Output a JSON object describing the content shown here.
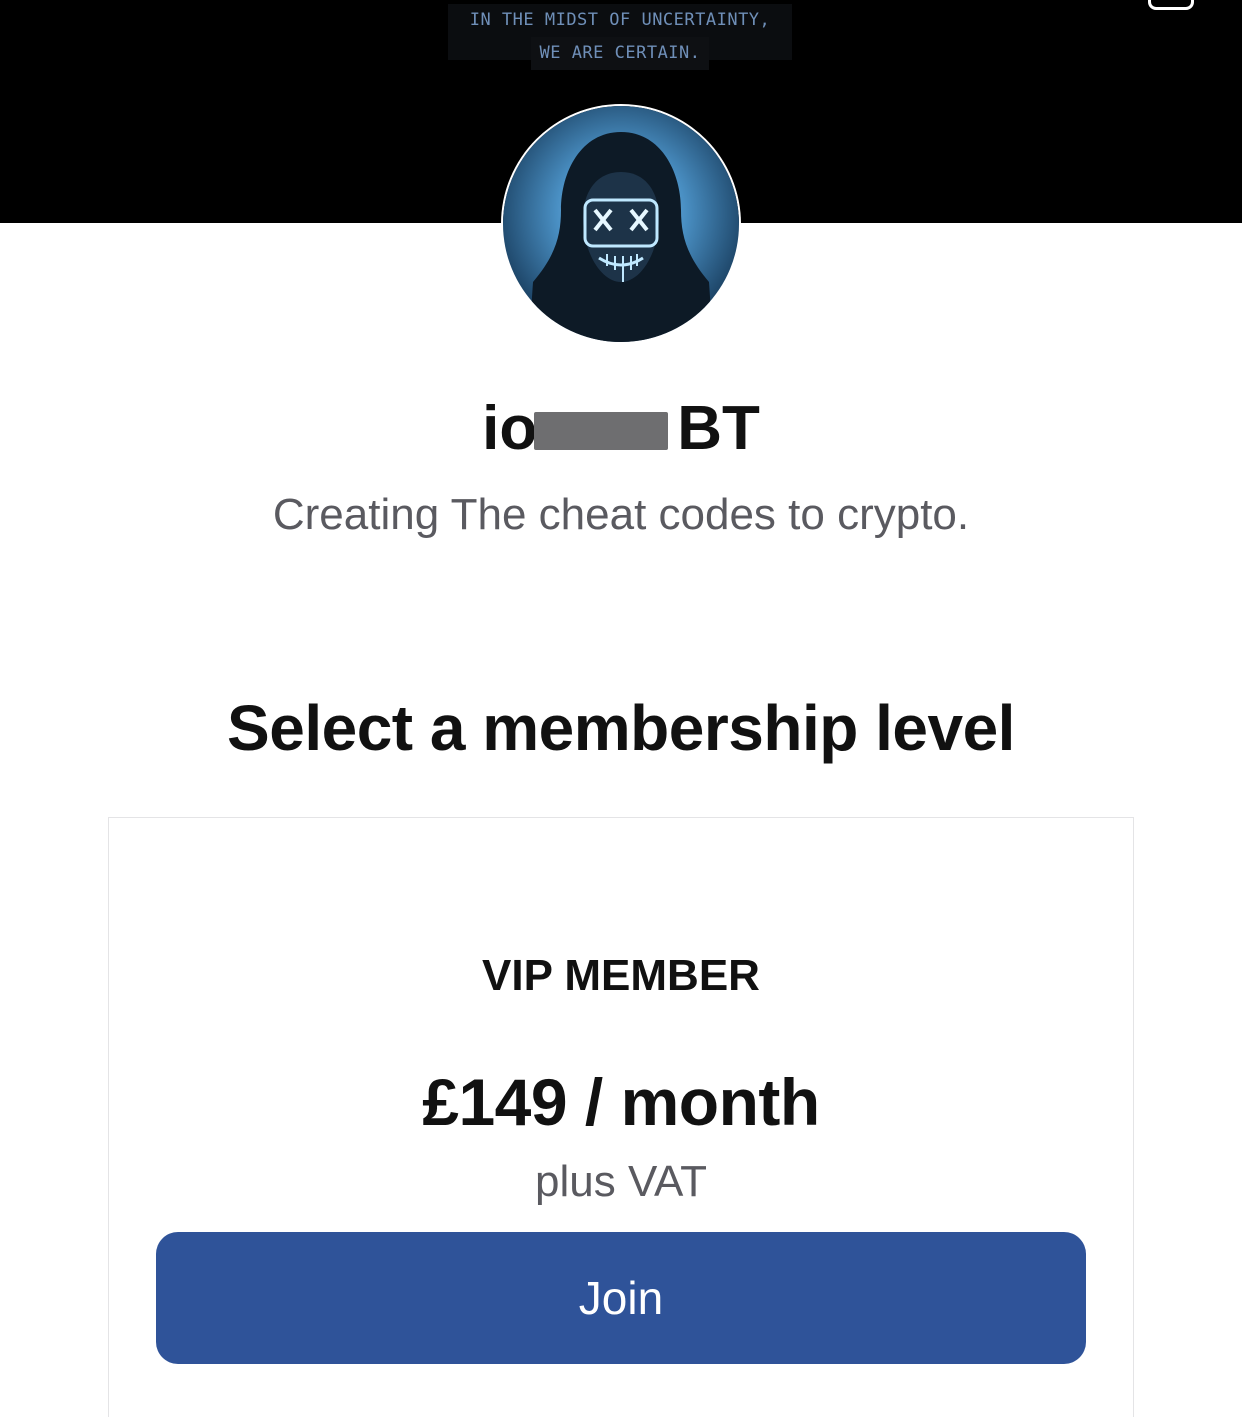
{
  "banner": {
    "quote_line1": "IN THE MIDST OF UNCERTAINTY,",
    "quote_line2": "WE ARE CERTAIN."
  },
  "creator": {
    "name_prefix": "io",
    "name_suffix": "BT",
    "tagline": "Creating The cheat codes to crypto."
  },
  "membership": {
    "title": "Select a membership level",
    "tiers": [
      {
        "name": "VIP MEMBER",
        "price": "£149 / month",
        "tax_note": "plus VAT",
        "join_label": "Join"
      }
    ]
  },
  "colors": {
    "banner_background": "#000000",
    "join_button": "#2f5399",
    "secondary_text": "#5a5a60"
  }
}
